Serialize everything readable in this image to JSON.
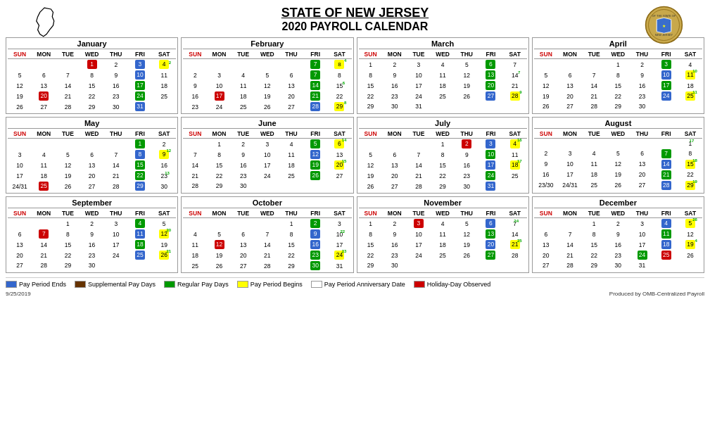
{
  "title1": "STATE OF NEW JERSEY",
  "title2": "2020 PAYROLL CALENDAR",
  "footer_date": "9/25/2019",
  "footer_credit": "Produced by OMB-Centralized Payroll",
  "legend": [
    {
      "color": "#3366cc",
      "label": "Pay Period Ends"
    },
    {
      "color": "#663300",
      "label": "Supplemental Pay Days"
    },
    {
      "color": "#009900",
      "label": "Regular Pay Days"
    },
    {
      "color": "#ffff00",
      "label": "Pay Period Begins"
    },
    {
      "color": "#ffffff",
      "label": "Pay Period Anniversary Date"
    },
    {
      "color": "#cc0000",
      "label": "Holiday-Day Observed"
    }
  ],
  "months": [
    {
      "name": "January"
    },
    {
      "name": "February"
    },
    {
      "name": "March"
    },
    {
      "name": "April"
    },
    {
      "name": "May"
    },
    {
      "name": "June"
    },
    {
      "name": "July"
    },
    {
      "name": "August"
    },
    {
      "name": "September"
    },
    {
      "name": "October"
    },
    {
      "name": "November"
    },
    {
      "name": "December"
    }
  ]
}
